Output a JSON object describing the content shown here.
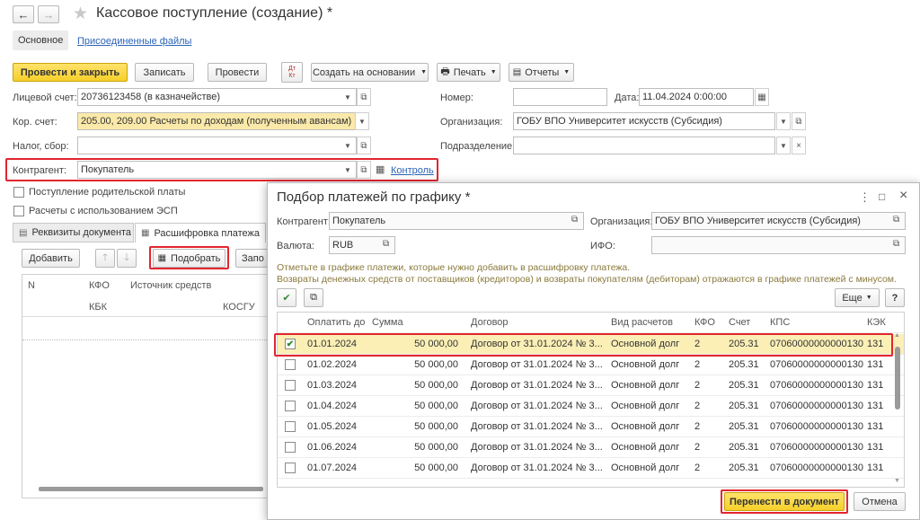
{
  "window": {
    "title": "Кассовое поступление (создание) *"
  },
  "nav_tabs": [
    "Основное",
    "Присоединенные файлы"
  ],
  "toolbar": {
    "post_close": "Провести и закрыть",
    "save": "Записать",
    "post": "Провести",
    "dtkt_icon": "Дт Кт",
    "create_based": "Создать на основании",
    "print": "Печать",
    "reports": "Отчеты"
  },
  "form": {
    "personal_account_label": "Лицевой счет:",
    "personal_account_value": "20736123458 (в казначействе)",
    "corr_account_label": "Кор. счет:",
    "corr_account_value": "205.00, 209.00 Расчеты по доходам (полученным авансам)",
    "tax_label": "Налог, сбор:",
    "tax_value": "",
    "counterparty_label": "Контрагент:",
    "counterparty_value": "Покупатель",
    "control_link": "Контроль",
    "number_label": "Номер:",
    "number_value": "",
    "date_label": "Дата:",
    "date_value": "11.04.2024  0:00:00",
    "org_label": "Организация:",
    "org_value": "ГОБУ ВПО Университет искусств (Субсидия)",
    "division_label": "Подразделение:",
    "division_value": "",
    "parent_fee_label": "Поступление родительской платы",
    "esp_label": "Расчеты с использованием ЭСП"
  },
  "doc_tabs": [
    "Реквизиты документа",
    "Расшифровка платежа"
  ],
  "table_toolbar": {
    "add": "Добавить",
    "pick": "Подобрать",
    "fill": "Запо"
  },
  "bg_table": {
    "col_n": "N",
    "col_kfo": "КФО",
    "col_source": "Источник средств",
    "col_kbk": "КБК",
    "col_kosgu": "КОСГУ"
  },
  "dialog": {
    "title": "Подбор платежей по графику *",
    "counterparty_label": "Контрагент:",
    "counterparty_value": "Покупатель",
    "org_label": "Организация:",
    "org_value": "ГОБУ ВПО Университет искусств (Субсидия)",
    "currency_label": "Валюта:",
    "currency_value": "RUB",
    "ifo_label": "ИФО:",
    "ifo_value": "",
    "hint_line1": "Отметьте в графике платежи, которые нужно добавить в расшифровку платежа.",
    "hint_line2": "Возвраты денежных средств от поставщиков (кредиторов) и возвраты покупателям (дебиторам) отражаются в графике платежей с минусом.",
    "more_button": "Еще",
    "help_button": "?",
    "columns": [
      "Оплатить до",
      "Сумма",
      "Договор",
      "Вид расчетов",
      "КФО",
      "Счет",
      "КПС",
      "КЭК"
    ],
    "rows": [
      {
        "checked": true,
        "date": "01.01.2024",
        "sum": "50 000,00",
        "contract": "Договор от 31.01.2024 № 3...",
        "calc_type": "Основной долг",
        "kfo": "2",
        "account": "205.31",
        "kps": "07060000000000130",
        "kek": "131"
      },
      {
        "checked": false,
        "date": "01.02.2024",
        "sum": "50 000,00",
        "contract": "Договор от 31.01.2024 № 3...",
        "calc_type": "Основной долг",
        "kfo": "2",
        "account": "205.31",
        "kps": "07060000000000130",
        "kek": "131"
      },
      {
        "checked": false,
        "date": "01.03.2024",
        "sum": "50 000,00",
        "contract": "Договор от 31.01.2024 № 3...",
        "calc_type": "Основной долг",
        "kfo": "2",
        "account": "205.31",
        "kps": "07060000000000130",
        "kek": "131"
      },
      {
        "checked": false,
        "date": "01.04.2024",
        "sum": "50 000,00",
        "contract": "Договор от 31.01.2024 № 3...",
        "calc_type": "Основной долг",
        "kfo": "2",
        "account": "205.31",
        "kps": "07060000000000130",
        "kek": "131"
      },
      {
        "checked": false,
        "date": "01.05.2024",
        "sum": "50 000,00",
        "contract": "Договор от 31.01.2024 № 3...",
        "calc_type": "Основной долг",
        "kfo": "2",
        "account": "205.31",
        "kps": "07060000000000130",
        "kek": "131"
      },
      {
        "checked": false,
        "date": "01.06.2024",
        "sum": "50 000,00",
        "contract": "Договор от 31.01.2024 № 3...",
        "calc_type": "Основной долг",
        "kfo": "2",
        "account": "205.31",
        "kps": "07060000000000130",
        "kek": "131"
      },
      {
        "checked": false,
        "date": "01.07.2024",
        "sum": "50 000,00",
        "contract": "Договор от 31.01.2024 № 3...",
        "calc_type": "Основной долг",
        "kfo": "2",
        "account": "205.31",
        "kps": "07060000000000130",
        "kek": "131"
      }
    ],
    "transfer_button": "Перенести в документ",
    "cancel_button": "Отмена"
  },
  "colors": {
    "highlight_red": "#e2262f",
    "yellow_button": "#f5cf2a",
    "selected_row": "#fbefb6",
    "link_blue": "#2b63b8"
  }
}
